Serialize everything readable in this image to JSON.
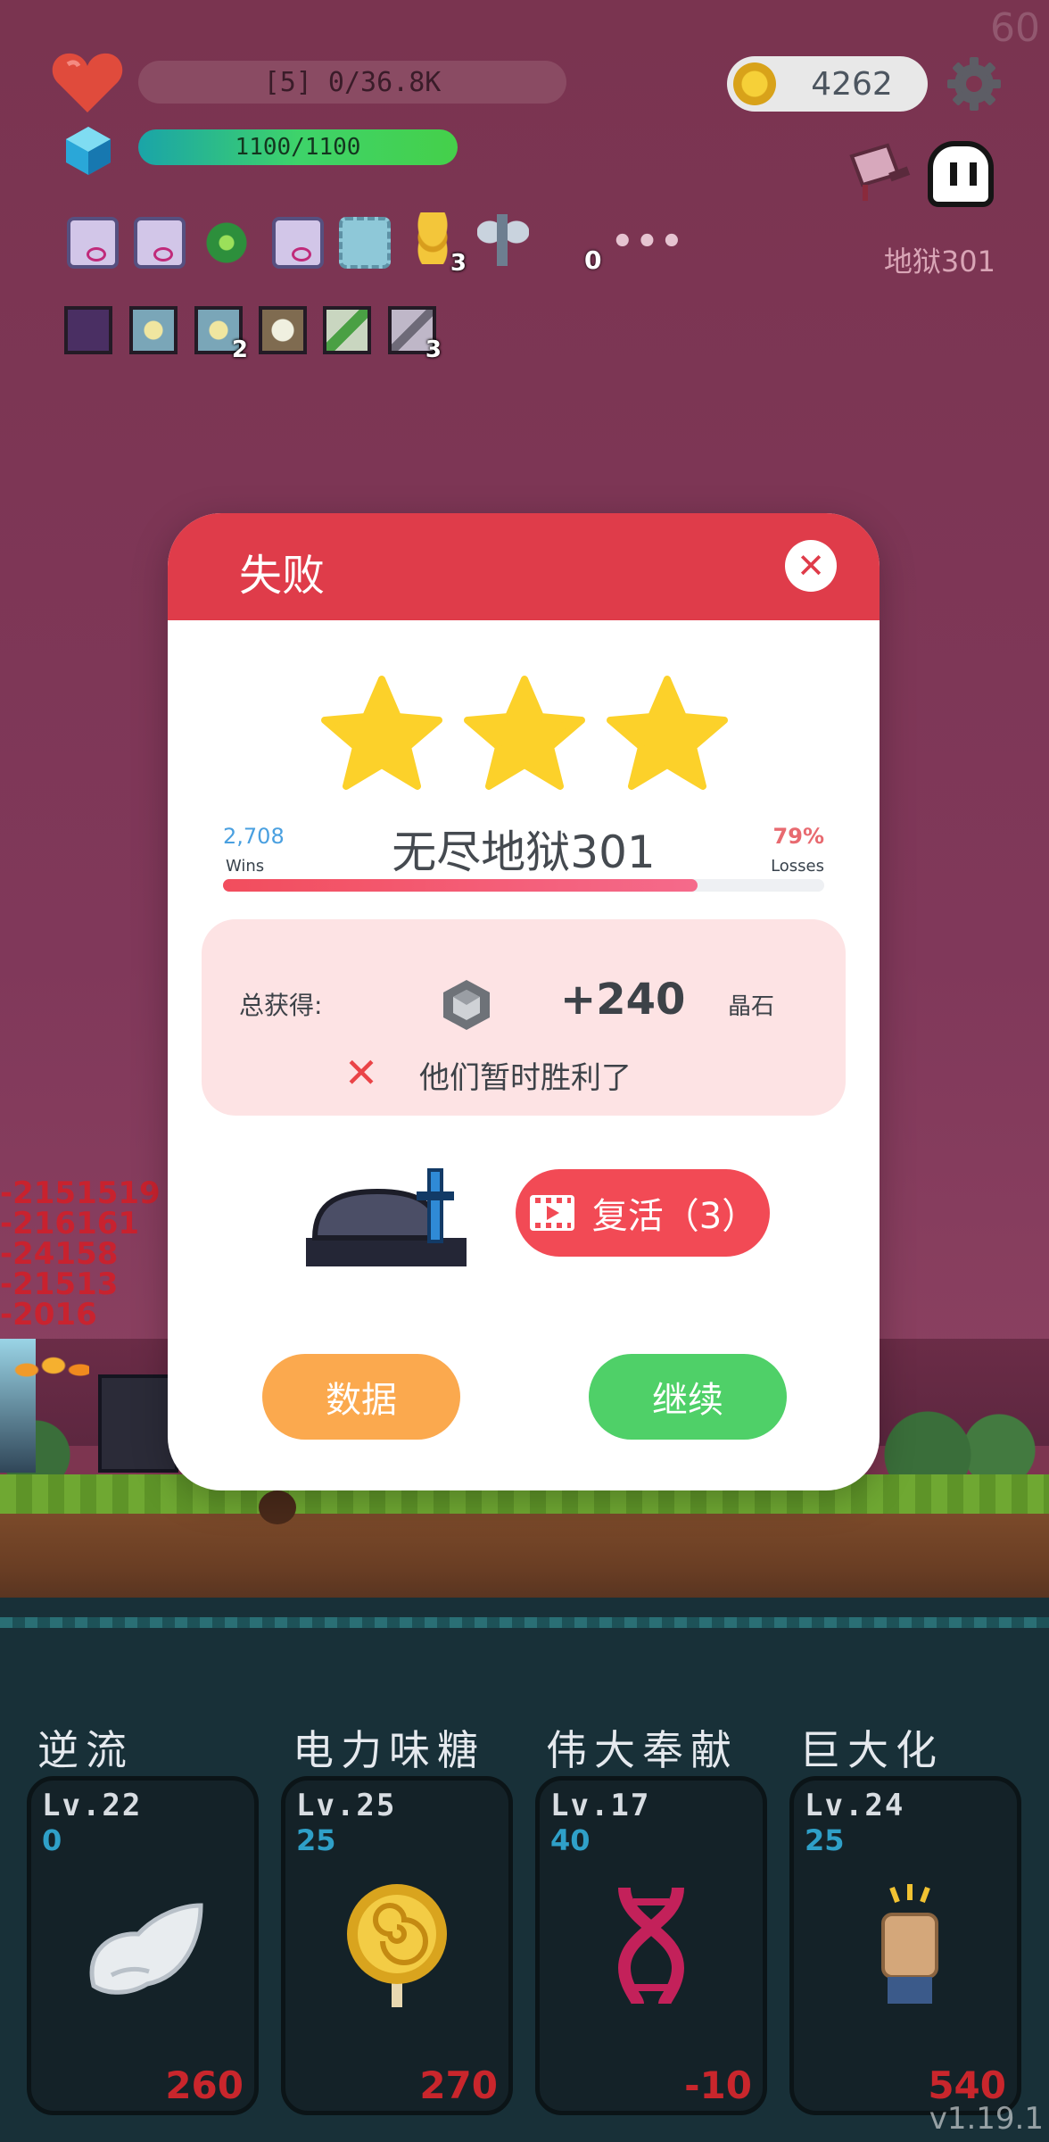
{
  "hud": {
    "fps": "60",
    "hp_text": "[5] 0/36.8K",
    "mana_text": "1100/1100",
    "coins": "4262",
    "level_label": "地狱301",
    "buff_zero": "0",
    "buff_more": "•••",
    "buffs": [
      {
        "icon": "scroll-icon",
        "badge": ""
      },
      {
        "icon": "scroll-icon",
        "badge": ""
      },
      {
        "icon": "biohazard-icon",
        "badge": ""
      },
      {
        "icon": "scroll-icon",
        "badge": ""
      },
      {
        "icon": "blue-frame-icon",
        "badge": ""
      },
      {
        "icon": "gold-coins-icon",
        "badge": "3"
      },
      {
        "icon": "battle-axe-icon",
        "badge": ""
      }
    ],
    "relics": [
      {
        "icon": "demon-relic-icon",
        "badge": ""
      },
      {
        "icon": "lightbulb-relic-icon",
        "badge": ""
      },
      {
        "icon": "lightbulb-relic-icon",
        "badge": "2"
      },
      {
        "icon": "sun-relic-icon",
        "badge": ""
      },
      {
        "icon": "leaf-relic-icon",
        "badge": ""
      },
      {
        "icon": "blade-relic-icon",
        "badge": "3"
      }
    ]
  },
  "modal": {
    "title": "失败",
    "close_symbol": "✕",
    "stars": 3,
    "wins_count": "2,708",
    "wins_label": "Wins",
    "mode_title": "无尽地狱301",
    "loss_pct": "79%",
    "loss_label": "Losses",
    "progress_fraction": 0.79,
    "reward_label": "总获得:",
    "reward_amount": "+240",
    "reward_unit": "晶石",
    "cross_symbol": "✕",
    "defeat_message": "他们暂时胜利了",
    "revive_label": "复活（3）",
    "stats_label": "数据",
    "continue_label": "继续"
  },
  "damage_text": "-2151519\n-216161\n-24158\n-21513\n-2016",
  "skills": [
    {
      "name": "逆流",
      "level": "Lv.22",
      "cost": "0",
      "value": "260",
      "icon": "wing-icon"
    },
    {
      "name": "电力味糖",
      "level": "Lv.25",
      "cost": "25",
      "value": "270",
      "icon": "lollipop-icon"
    },
    {
      "name": "伟大奉献",
      "level": "Lv.17",
      "cost": "40",
      "value": "-10",
      "icon": "dna-icon"
    },
    {
      "name": "巨大化",
      "level": "Lv.24",
      "cost": "25",
      "value": "540",
      "icon": "fist-icon"
    }
  ],
  "version": "v1.19.1",
  "colors": {
    "header_red": "#df3c4a",
    "revive_red": "#f24a55",
    "stats_orange": "#fba94e",
    "continue_green": "#4fd068",
    "star_yellow": "#fcd12a",
    "wins_blue": "#4aa0e0",
    "loss_red": "#e86a70"
  }
}
